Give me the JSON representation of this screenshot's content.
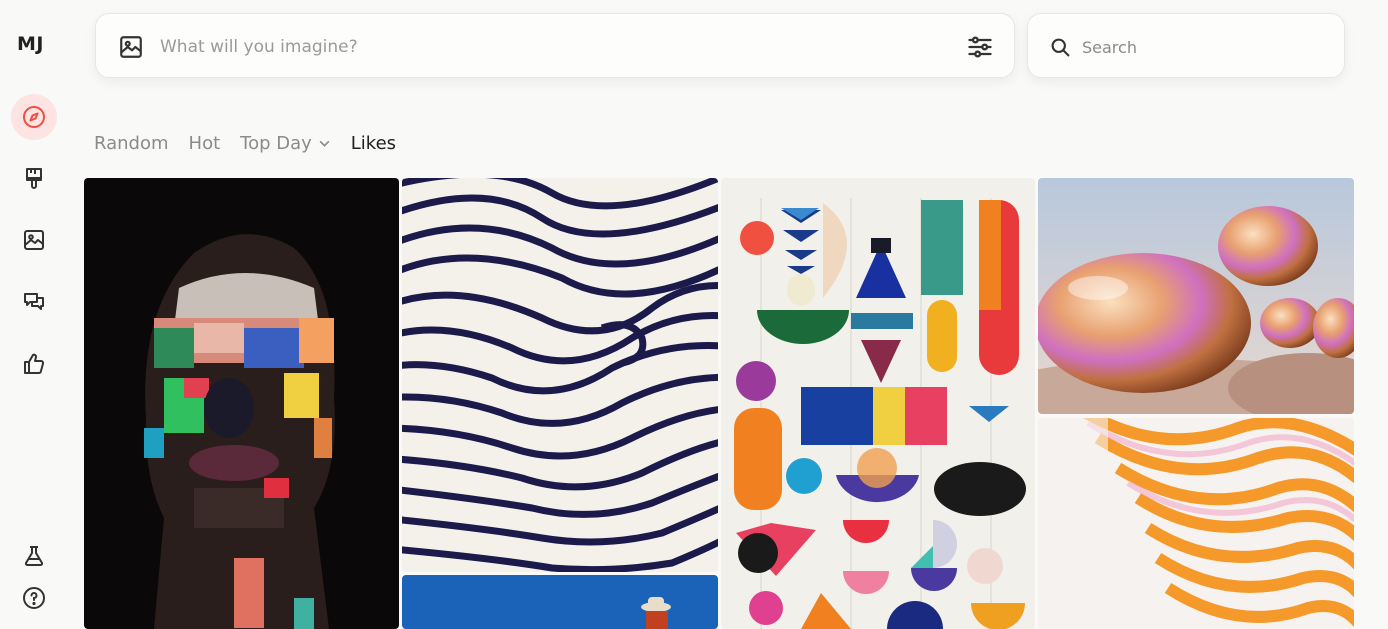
{
  "sidebar": {
    "logo": "MJ",
    "items": [
      {
        "name": "explore",
        "icon": "compass-icon",
        "active": true
      },
      {
        "name": "create",
        "icon": "paintbrush-icon",
        "active": false
      },
      {
        "name": "organize",
        "icon": "image-icon",
        "active": false
      },
      {
        "name": "chat",
        "icon": "chat-icon",
        "active": false
      },
      {
        "name": "rate",
        "icon": "thumbs-up-icon",
        "active": false
      },
      {
        "name": "labs",
        "icon": "flask-icon",
        "active": false
      },
      {
        "name": "help",
        "icon": "help-icon",
        "active": false
      }
    ]
  },
  "prompt": {
    "placeholder": "What will you imagine?",
    "value": ""
  },
  "search": {
    "placeholder": "Search",
    "value": ""
  },
  "tabs": [
    {
      "label": "Random",
      "active": false
    },
    {
      "label": "Hot",
      "active": false
    },
    {
      "label": "Top Day",
      "active": false,
      "dropdown": true
    },
    {
      "label": "Likes",
      "active": true
    }
  ],
  "gallery": {
    "items": [
      {
        "id": "painted-portrait",
        "alt": "abstract painted portrait"
      },
      {
        "id": "fingerprint-lines",
        "alt": "wavy black and white lines"
      },
      {
        "id": "geometric-shapes",
        "alt": "colorful geometric shapes"
      },
      {
        "id": "iridescent-spheres",
        "alt": "iridescent metallic blobs"
      },
      {
        "id": "orange-waves",
        "alt": "orange wavy stripes"
      },
      {
        "id": "blue-hat-figure",
        "alt": "figure with hat on blue"
      }
    ]
  },
  "colors": {
    "accent": "#f04e3e",
    "active_bg": "#fde3e1",
    "background": "#f9f9f8",
    "text": "#222222",
    "muted": "#8b8b8b"
  }
}
